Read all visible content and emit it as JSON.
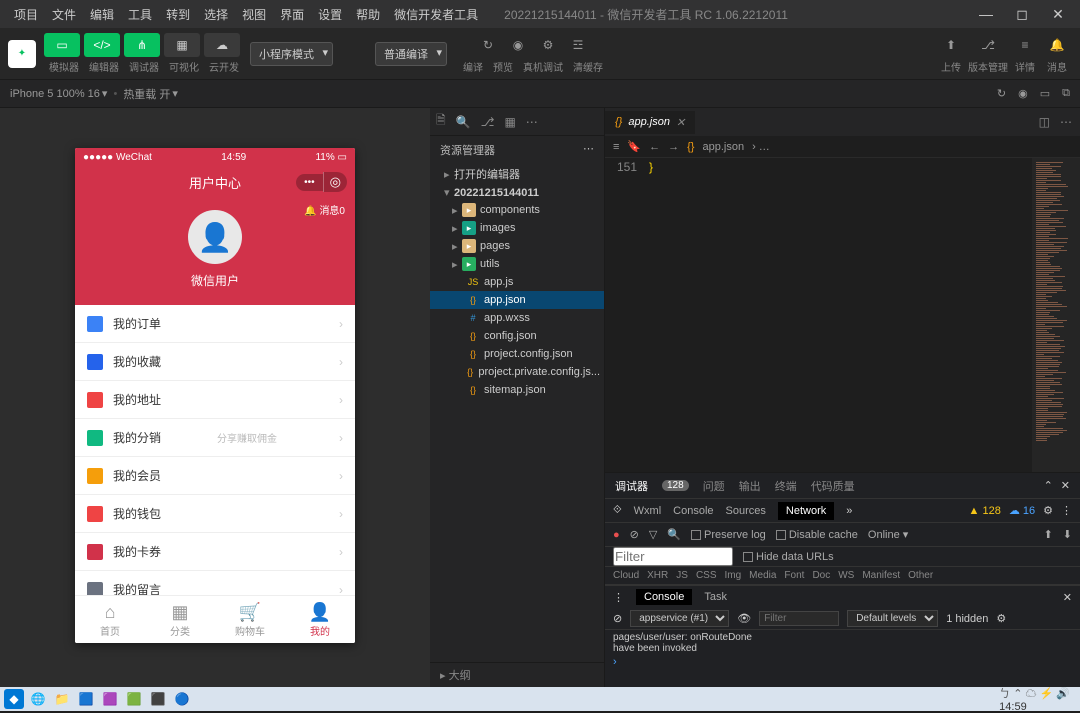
{
  "menubar": {
    "items": [
      "项目",
      "文件",
      "编辑",
      "工具",
      "转到",
      "选择",
      "视图",
      "界面",
      "设置",
      "帮助",
      "微信开发者工具"
    ],
    "title": "20221215144011 - 微信开发者工具 RC 1.06.2212011"
  },
  "toolbar": {
    "labels": {
      "simulator": "模拟器",
      "editor": "编辑器",
      "debugger": "调试器",
      "visualize": "可视化",
      "cloud": "云开发"
    },
    "mode_select": "小程序模式",
    "compile_select": "普通编译",
    "center_labels": {
      "compile": "编译",
      "preview": "预览",
      "remote": "真机调试",
      "cache": "清缓存"
    },
    "right_labels": {
      "upload": "上传",
      "version": "版本管理",
      "detail": "详情",
      "message": "消息"
    }
  },
  "simbar": {
    "device": "iPhone 5 100% 16",
    "reload": "热重载 开"
  },
  "phone": {
    "status": {
      "carrier": "●●●●● WeChat",
      "time": "14:59",
      "battery": "11%"
    },
    "nav_title": "用户中心",
    "msg_badge": "消息0",
    "username": "微信用户",
    "items": [
      {
        "label": "我的订单",
        "color": "#3b82f6"
      },
      {
        "label": "我的收藏",
        "color": "#2563eb"
      },
      {
        "label": "我的地址",
        "color": "#ef4444"
      },
      {
        "label": "我的分销",
        "color": "#10b981",
        "sub": "分享赚取佣金"
      },
      {
        "label": "我的会员",
        "color": "#f59e0b"
      },
      {
        "label": "我的钱包",
        "color": "#ef4444"
      },
      {
        "label": "我的卡券",
        "color": "#d1324a"
      },
      {
        "label": "我的留言",
        "color": "#6b7280"
      }
    ],
    "tabs": [
      {
        "label": "首页",
        "icon": "⌂"
      },
      {
        "label": "分类",
        "icon": "▦"
      },
      {
        "label": "购物车",
        "icon": "🛒"
      },
      {
        "label": "我的",
        "icon": "👤",
        "active": true
      }
    ]
  },
  "explorer": {
    "title": "资源管理器",
    "open_editors": "打开的编辑器",
    "project": "20221215144011",
    "folders": [
      {
        "name": "components",
        "color": "#dcb67a"
      },
      {
        "name": "images",
        "color": "#16a085"
      },
      {
        "name": "pages",
        "color": "#dcb67a"
      },
      {
        "name": "utils",
        "color": "#27ae60"
      }
    ],
    "files": [
      {
        "name": "app.js",
        "icon": "JS",
        "color": "#f1c40f"
      },
      {
        "name": "app.json",
        "icon": "{}",
        "color": "#f39c12",
        "selected": true
      },
      {
        "name": "app.wxss",
        "icon": "#",
        "color": "#3498db"
      },
      {
        "name": "config.json",
        "icon": "{}",
        "color": "#f39c12"
      },
      {
        "name": "project.config.json",
        "icon": "{}",
        "color": "#f39c12"
      },
      {
        "name": "project.private.config.js...",
        "icon": "{}",
        "color": "#f39c12"
      },
      {
        "name": "sitemap.json",
        "icon": "{}",
        "color": "#f39c12"
      }
    ],
    "outline": "大纲"
  },
  "editor": {
    "tab_name": "app.json",
    "breadcrumb": "app.json",
    "line_no": "151",
    "code": "}"
  },
  "debugger": {
    "tabs": {
      "main": "调试器",
      "badge": "128",
      "problem": "问题",
      "output": "输出",
      "terminal": "终端",
      "quality": "代码质量"
    },
    "devtools": [
      "Wxml",
      "Console",
      "Sources",
      "Network"
    ],
    "warn_count": "128",
    "info_count": "16",
    "netbar": {
      "preserve": "Preserve log",
      "disable_cache": "Disable cache",
      "online": "Online"
    },
    "filter_placeholder": "Filter",
    "hide_urls": "Hide data URLs",
    "types": [
      "Cloud",
      "XHR",
      "JS",
      "CSS",
      "Img",
      "Media",
      "Font",
      "Doc",
      "WS",
      "Manifest",
      "Other"
    ],
    "console_tabs": {
      "console": "Console",
      "task": "Task"
    },
    "context": "appservice (#1)",
    "levels": "Default levels",
    "hidden": "1 hidden",
    "console_lines": [
      "pages/user/user: onRouteDone",
      "have been invoked"
    ],
    "filter2_placeholder": "Filter"
  },
  "taskbar": {
    "clock": "14:59"
  }
}
